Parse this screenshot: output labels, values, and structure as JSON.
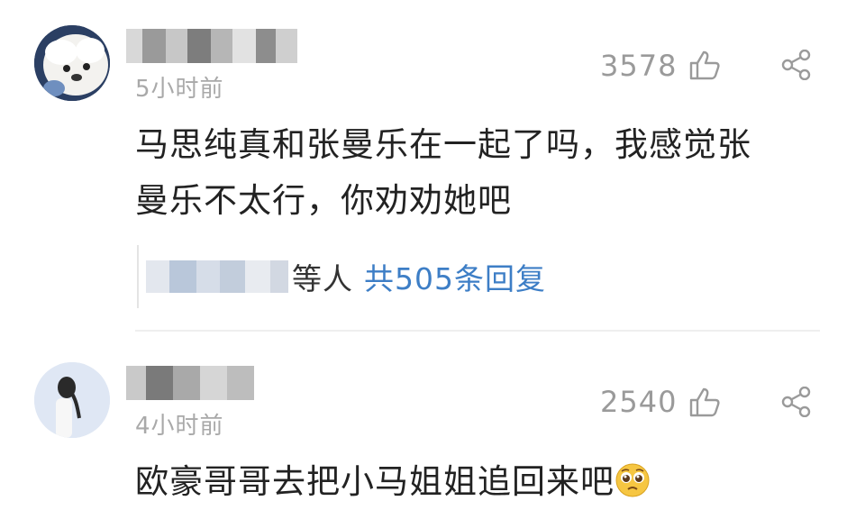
{
  "comments": [
    {
      "time": "5小时前",
      "likes": "3578",
      "text_line1": "马思纯真和张曼乐在一起了吗，我感觉张",
      "text_line2": "曼乐不太行，你劝劝她吧",
      "reply_suffix": "等人",
      "reply_count": "共505条回复",
      "avatar": "white-dog-avatar"
    },
    {
      "time": "4小时前",
      "likes": "2540",
      "text": "欧豪哥哥去把小马姐姐追回来吧",
      "emoji": "pleading-face-emoji",
      "avatar": "girl-profile-avatar"
    }
  ],
  "colors": {
    "link": "#3d7ec6",
    "muted": "#a9a9a9",
    "text": "#222222"
  }
}
